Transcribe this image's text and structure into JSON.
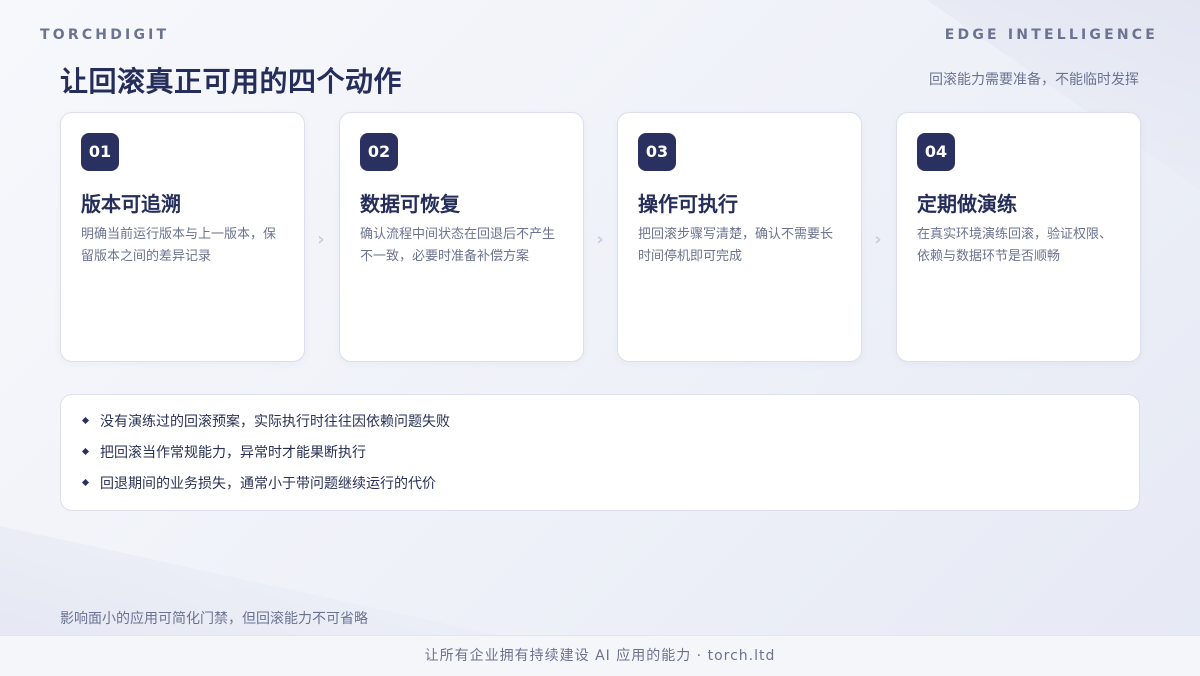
{
  "header": {
    "brand_left": "TORCHDIGIT",
    "brand_right": "EDGE INTELLIGENCE",
    "title": "让回滚真正可用的四个动作",
    "subtitle": "回滚能力需要准备，不能临时发挥"
  },
  "cards": [
    {
      "number": "01",
      "title": "版本可追溯",
      "desc": "明确当前运行版本与上一版本，保留版本之间的差异记录"
    },
    {
      "number": "02",
      "title": "数据可恢复",
      "desc": "确认流程中间状态在回退后不产生不一致，必要时准备补偿方案"
    },
    {
      "number": "03",
      "title": "操作可执行",
      "desc": "把回滚步骤写清楚，确认不需要长时间停机即可完成"
    },
    {
      "number": "04",
      "title": "定期做演练",
      "desc": "在真实环境演练回滚，验证权限、依赖与数据环节是否顺畅"
    }
  ],
  "notes": [
    "没有演练过的回滚预案，实际执行时往往因依赖问题失败",
    "把回滚当作常规能力，异常时才能果断执行",
    "回退期间的业务损失，通常小于带问题继续运行的代价"
  ],
  "footnote": "影响面小的应用可简化门禁，但回滚能力不可省略",
  "footer": "让所有企业拥有持续建设 AI 应用的能力 · torch.ltd",
  "colors": {
    "accent": "#2a3160",
    "muted": "#6b7391",
    "card_border": "#dcdfeb"
  }
}
